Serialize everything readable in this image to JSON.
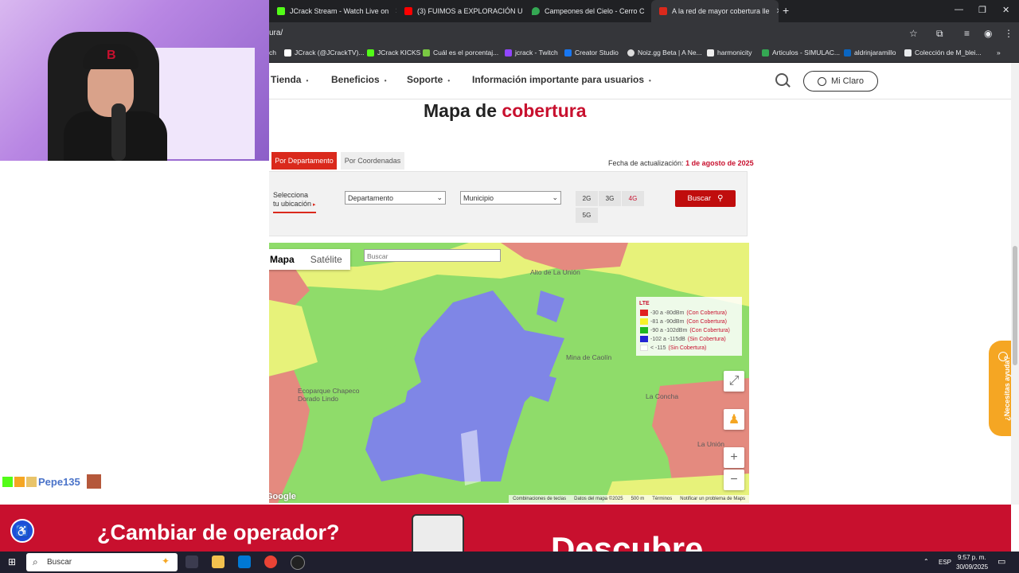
{
  "browser": {
    "tabs": [
      {
        "title": "JCrack Stream - Watch Live on",
        "color": "#53fc18"
      },
      {
        "title": "(3) FUIMOS a EXPLORACIÓN U",
        "color": "#ff0000"
      },
      {
        "title": "Campeones del Cielo - Cerro C",
        "color": "#34a853"
      },
      {
        "title": "A la red de mayor cobertura lle",
        "color": "#da291c"
      }
    ],
    "url": "ura/",
    "bookmarks": [
      "ch",
      "JCrack (@JCrackTV)...",
      "JCrack KICKS",
      "Cuál es el porcentaj...",
      "jcrack - Twitch",
      "Creator Studio",
      "Noiz.gg Beta | A Ne...",
      "harmonicity",
      "Articulos - SIMULAC...",
      "aldrinjaramillo",
      "Colección de M_blei..."
    ]
  },
  "nav": {
    "items": [
      "Tienda",
      "Beneficios",
      "Soporte",
      "Información importante para usuarios"
    ],
    "mi_claro": "Mi Claro"
  },
  "page": {
    "title_prefix": "Mapa de",
    "title_highlight": "cobertura",
    "tab_departamento": "Por Departamento",
    "tab_coordenadas": "Por Coordenadas",
    "fecha_label": "Fecha de actualización:",
    "fecha_value": "1 de agosto de 2025"
  },
  "filter": {
    "label_line1": "Selecciona",
    "label_line2": "tu ubicación",
    "departamento": "Departamento",
    "municipio": "Municipio",
    "networks": [
      "2G",
      "3G",
      "4G",
      "5G"
    ],
    "selected_network": "4G",
    "buscar": "Buscar"
  },
  "map": {
    "tab_mapa": "Mapa",
    "tab_satelite": "Satélite",
    "search_placeholder": "Buscar",
    "legend": {
      "title": "LTE",
      "rows": [
        {
          "range": "-30 a -80dBm",
          "status": "(Con Cobertura)",
          "color": "#e02020"
        },
        {
          "range": "-81 a -90dBm",
          "status": "(Con Cobertura)",
          "color": "#f7f22a"
        },
        {
          "range": "-90 a -102dBm",
          "status": "(Con Cobertura)",
          "color": "#1fb81f"
        },
        {
          "range": "-102 a -115dB",
          "status": "(Sin Cobertura)",
          "color": "#2323d4"
        },
        {
          "range": "< -115",
          "status": "(Sin Cobertura)",
          "color": "#ffffff"
        }
      ]
    },
    "places": [
      "Alto de La Unión",
      "Mina de Caolín",
      "Ecoparque Chapeco Dorado Lindo",
      "La Concha",
      "La Unión"
    ],
    "footer": [
      "Combinaciones de teclas",
      "Datos del mapa ©2025",
      "500 m",
      "Términos",
      "Notificar un problema de Maps"
    ],
    "google": "Google"
  },
  "help": {
    "label": "¿Necesitas ayuda?"
  },
  "banner": {
    "headline": "¿Cambiar de operador?",
    "word": "Descubre"
  },
  "stream": {
    "chat_user": "Pepe135"
  },
  "taskbar": {
    "search": "Buscar",
    "lang": "ESP",
    "time": "9:57 p. m.",
    "date": "30/09/2025"
  }
}
